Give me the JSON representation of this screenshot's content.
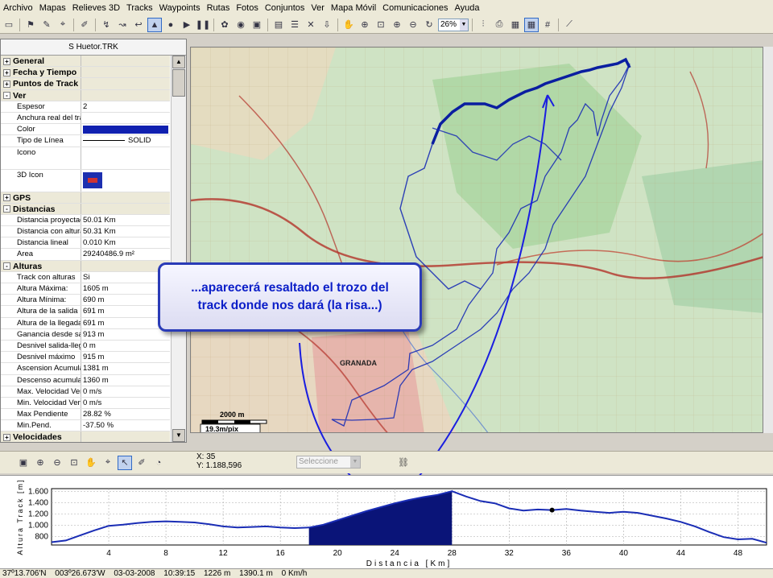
{
  "menu": [
    "Archivo",
    "Mapas",
    "Relieves 3D",
    "Tracks",
    "Waypoints",
    "Rutas",
    "Fotos",
    "Conjuntos",
    "Ver",
    "Mapa Móvil",
    "Comunicaciones",
    "Ayuda"
  ],
  "toolbar": {
    "zoom_value": "26%"
  },
  "panel": {
    "title": "S Huetor.TRK",
    "rows": [
      {
        "type": "cat",
        "sign": "+",
        "label": "General",
        "value": ""
      },
      {
        "type": "cat",
        "sign": "+",
        "label": "Fecha y Tiempo",
        "value": ""
      },
      {
        "type": "cat",
        "sign": "+",
        "label": "Puntos de Track",
        "value": ""
      },
      {
        "type": "cat",
        "sign": "-",
        "label": "Ver",
        "value": ""
      },
      {
        "type": "prop",
        "label": "Espesor",
        "value": "2"
      },
      {
        "type": "prop",
        "label": "Anchura real del trazo",
        "value": ""
      },
      {
        "type": "color",
        "label": "Color",
        "value": ""
      },
      {
        "type": "line",
        "label": "Tipo de Línea",
        "value": "SOLID"
      },
      {
        "type": "tall",
        "label": "Icono",
        "value": ""
      },
      {
        "type": "icon3d",
        "label": "3D Icon",
        "value": ""
      },
      {
        "type": "cat",
        "sign": "+",
        "label": "GPS",
        "value": ""
      },
      {
        "type": "cat",
        "sign": "-",
        "label": "Distancias",
        "value": ""
      },
      {
        "type": "prop",
        "label": "Distancia proyectada",
        "value": "50.01 Km"
      },
      {
        "type": "prop",
        "label": "Distancia con alturas",
        "value": "50.31 Km"
      },
      {
        "type": "prop",
        "label": "Distancia lineal",
        "value": "0.010 Km"
      },
      {
        "type": "prop",
        "label": "Area",
        "value": "29240486.9 m²"
      },
      {
        "type": "cat",
        "sign": "-",
        "label": "Alturas",
        "value": ""
      },
      {
        "type": "prop",
        "label": "Track con alturas",
        "value": "Si"
      },
      {
        "type": "prop",
        "label": "Altura Máxima:",
        "value": "1605 m"
      },
      {
        "type": "prop",
        "label": "Altura Mínima:",
        "value": "690 m"
      },
      {
        "type": "prop",
        "label": "Altura de la salida",
        "value": "691 m"
      },
      {
        "type": "prop",
        "label": "Altura de la llegada",
        "value": "691 m"
      },
      {
        "type": "prop",
        "label": "Ganancia desde salida",
        "value": "913 m"
      },
      {
        "type": "prop",
        "label": "Desnivel salida-llegada",
        "value": "0 m"
      },
      {
        "type": "prop",
        "label": "Desnivel máximo",
        "value": "915 m"
      },
      {
        "type": "prop",
        "label": "Ascension Acumulada",
        "value": "1381 m"
      },
      {
        "type": "prop",
        "label": "Descenso acumulado",
        "value": "1360 m"
      },
      {
        "type": "prop",
        "label": "Max. Velocidad Vertical",
        "value": "0 m/s"
      },
      {
        "type": "prop",
        "label": "Min. Velocidad Vertical",
        "value": "0 m/s"
      },
      {
        "type": "prop",
        "label": "Max Pendiente",
        "value": "28.82 %"
      },
      {
        "type": "prop",
        "label": "Min.Pend.",
        "value": "-37.50 %"
      },
      {
        "type": "cat",
        "sign": "+",
        "label": "Velocidades",
        "value": ""
      }
    ]
  },
  "map": {
    "city_label": "GRANADA",
    "scale_label": "2000 m",
    "resolution_label": "19.3m/pix",
    "track_color": "#1020b0"
  },
  "callout": {
    "line1": "...aparecerá resaltado el trozo del",
    "line2": "track donde nos dará (la risa...)"
  },
  "profile_toolbar": {
    "coord_x": "X: 35",
    "coord_y": "Y: 1.188,596",
    "select_placeholder": "Seleccione"
  },
  "profile": {
    "ylabel": "Altura Track [m]",
    "xlabel": "Distancia [Km]",
    "yticks": [
      "1.600",
      "1.400",
      "1.200",
      "1.000",
      "800"
    ],
    "xticks": [
      "4",
      "8",
      "12",
      "16",
      "20",
      "24",
      "28",
      "32",
      "36",
      "40",
      "44",
      "48"
    ],
    "highlight_range_km": [
      18,
      28
    ],
    "marker_km": 35
  },
  "chart_data": {
    "type": "line",
    "xlabel": "Distancia [Km]",
    "ylabel": "Altura Track [m]",
    "xlim": [
      0,
      50
    ],
    "ylim": [
      650,
      1650
    ],
    "x": [
      0,
      1,
      2,
      3,
      4,
      5,
      6,
      7,
      8,
      9,
      10,
      11,
      12,
      13,
      14,
      15,
      16,
      17,
      18,
      19,
      20,
      21,
      22,
      23,
      24,
      25,
      26,
      27,
      28,
      29,
      30,
      31,
      32,
      33,
      34,
      35,
      36,
      37,
      38,
      39,
      40,
      41,
      42,
      43,
      44,
      45,
      46,
      47,
      48,
      49,
      50
    ],
    "series": [
      {
        "values": [
          700,
          730,
          820,
          910,
          990,
          1010,
          1040,
          1060,
          1070,
          1060,
          1050,
          1020,
          980,
          960,
          970,
          980,
          960,
          950,
          960,
          1010,
          1090,
          1170,
          1250,
          1320,
          1390,
          1450,
          1500,
          1540,
          1605,
          1510,
          1430,
          1390,
          1300,
          1260,
          1280,
          1270,
          1290,
          1260,
          1240,
          1220,
          1240,
          1220,
          1170,
          1120,
          1060,
          980,
          880,
          790,
          750,
          760,
          690
        ]
      }
    ]
  },
  "status": {
    "lat": "37º13.706'N",
    "lon": "003º26.673'W",
    "date": "03-03-2008",
    "time": "10:39:15",
    "alt": "1226 m",
    "dist": "1390.1 m",
    "speed": "0 Km/h"
  }
}
